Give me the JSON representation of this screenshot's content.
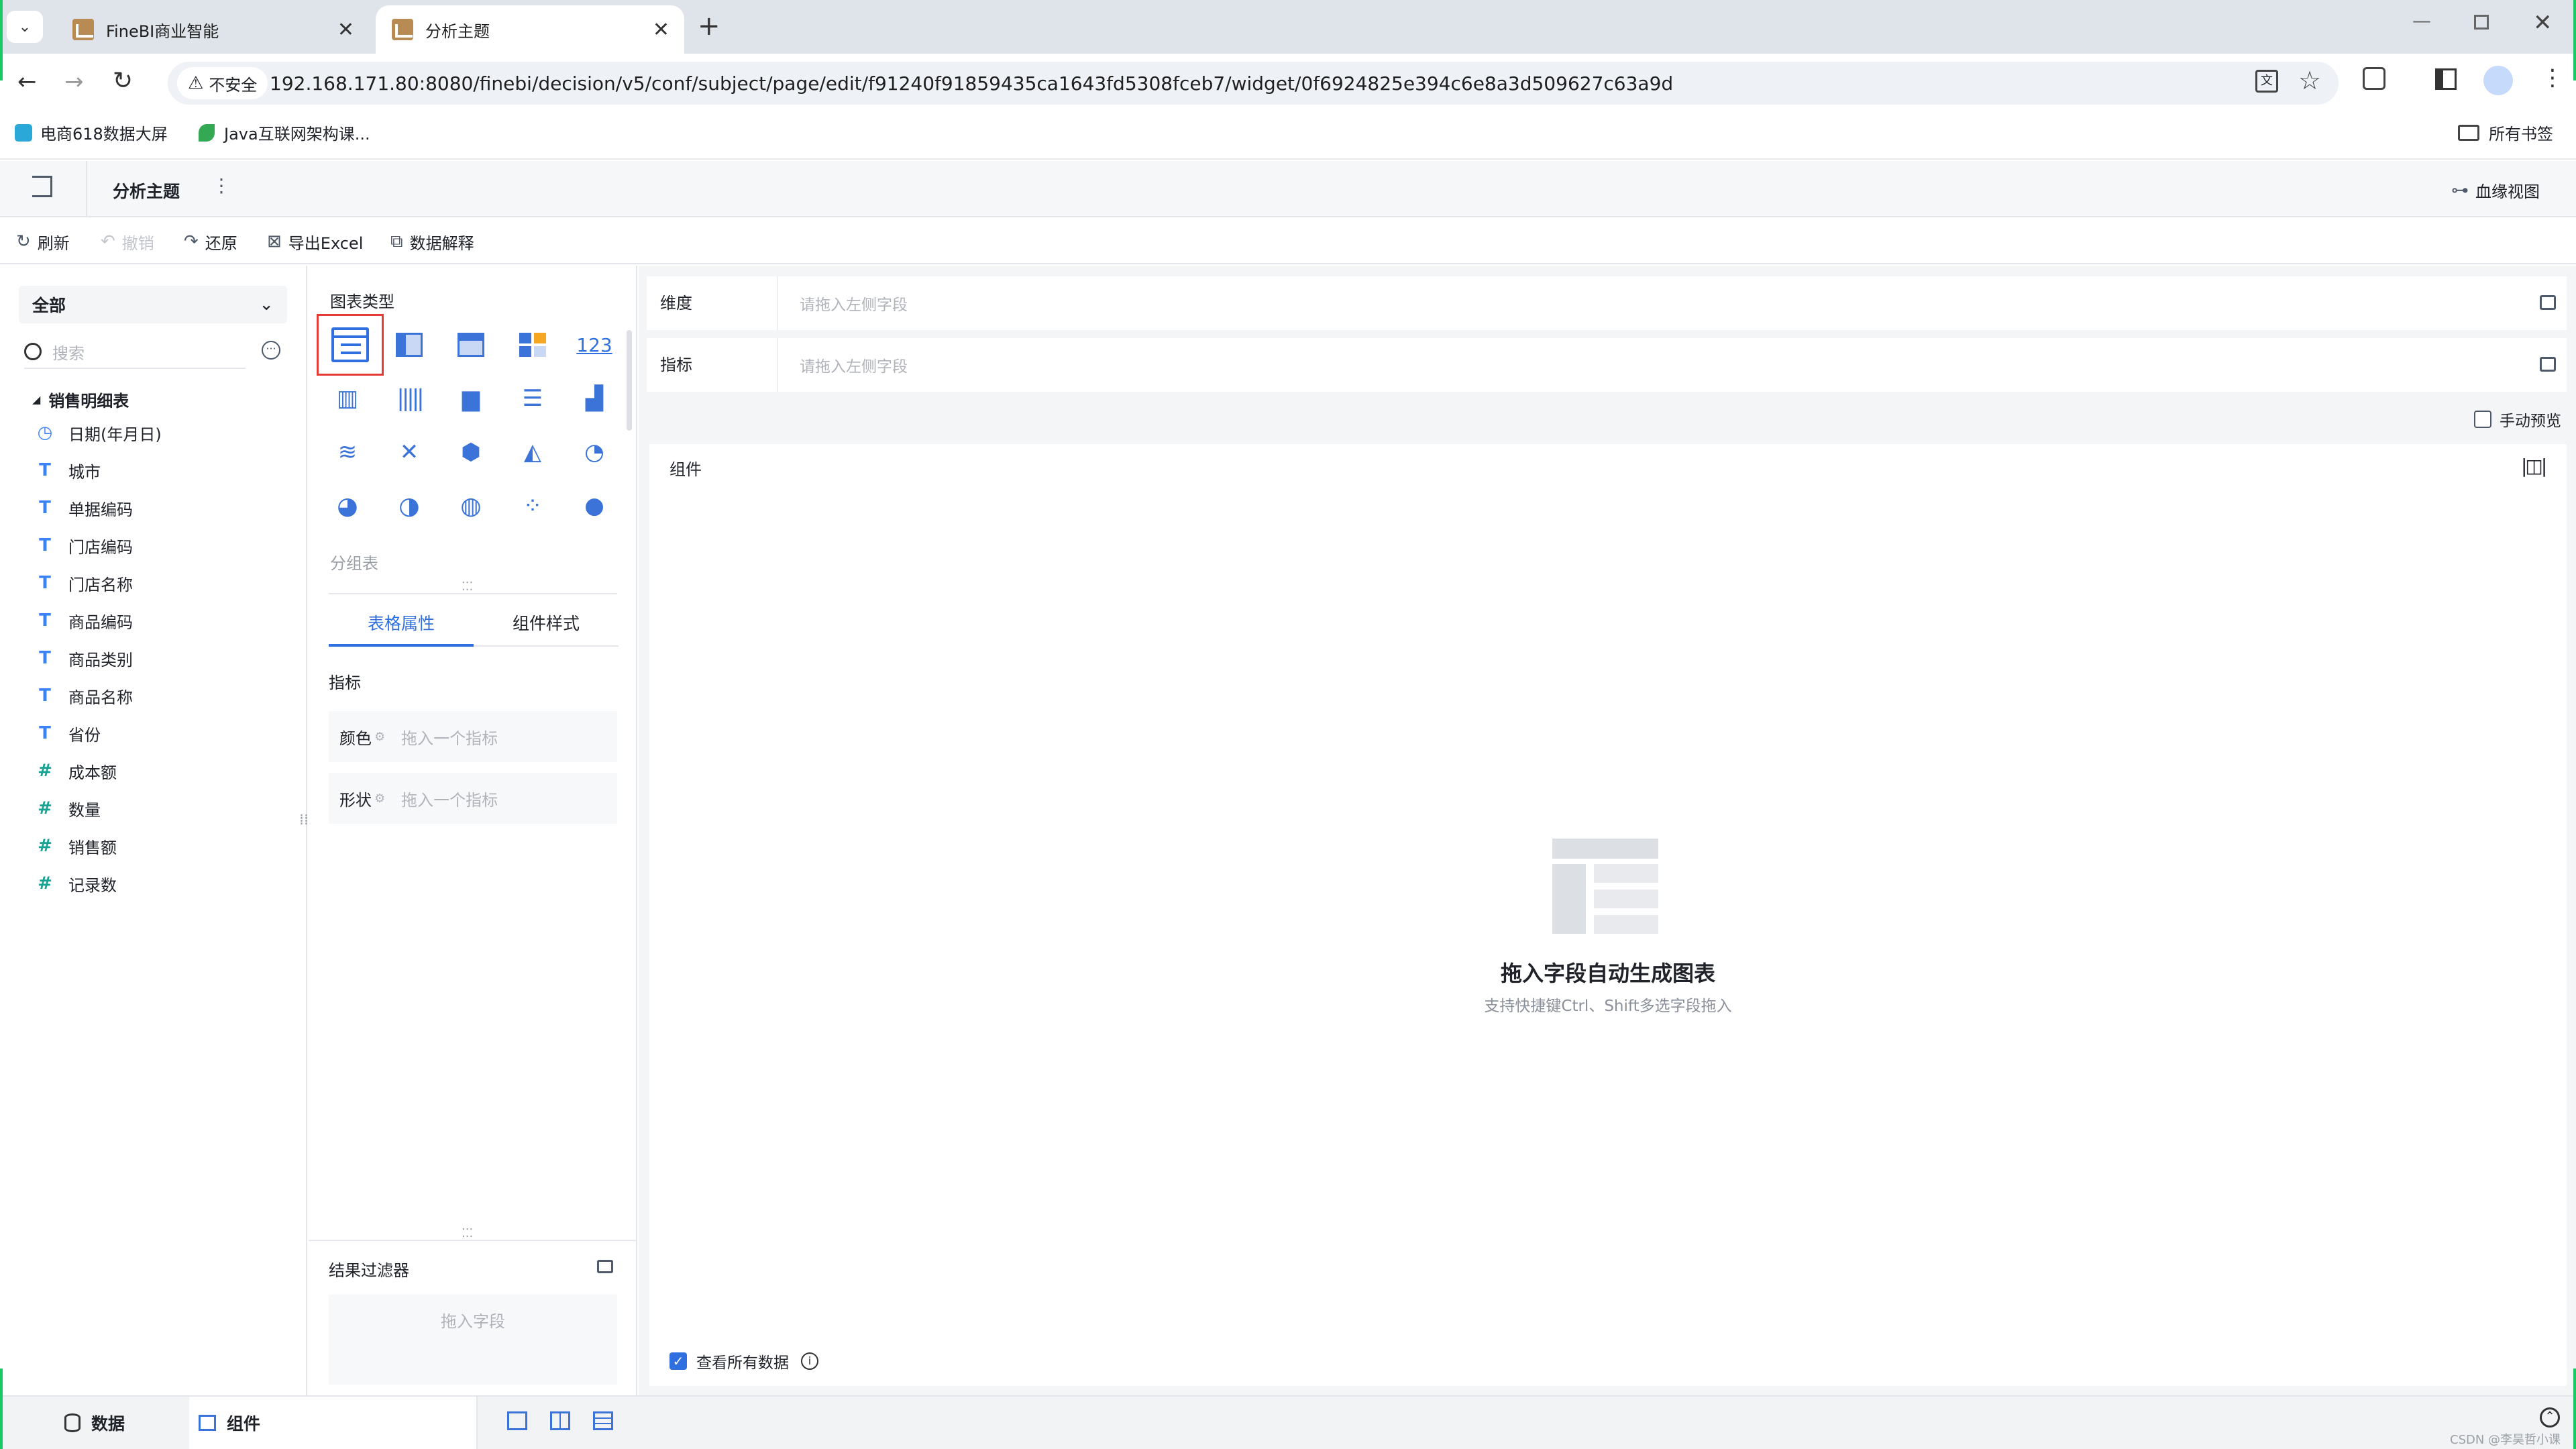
{
  "browser": {
    "tabs": [
      {
        "title": "FineBI商业智能",
        "active": false
      },
      {
        "title": "分析主题",
        "active": true
      }
    ],
    "url": "192.168.171.80:8080/finebi/decision/v5/conf/subject/page/edit/f91240f91859435ca1643fd5308fceb7/widget/0f6924825e394c6e8a3d509627c63a9d",
    "security_label": "不安全",
    "bookmarks": [
      {
        "label": "电商618数据大屏"
      },
      {
        "label": "Java互联网架构课..."
      }
    ],
    "all_bookmarks": "所有书签"
  },
  "app": {
    "title": "分析主题",
    "lineage": "血缘视图",
    "actions": {
      "refresh": "刷新",
      "undo": "撤销",
      "redo": "还原",
      "export": "导出Excel",
      "explain": "数据解释"
    }
  },
  "left": {
    "scope": "全部",
    "search_placeholder": "搜索",
    "table_name": "销售明细表",
    "fields": [
      {
        "label": "日期(年月日)",
        "kind": "date"
      },
      {
        "label": "城市",
        "kind": "text"
      },
      {
        "label": "单据编码",
        "kind": "text"
      },
      {
        "label": "门店编码",
        "kind": "text"
      },
      {
        "label": "门店名称",
        "kind": "text"
      },
      {
        "label": "商品编码",
        "kind": "text"
      },
      {
        "label": "商品类别",
        "kind": "text"
      },
      {
        "label": "商品名称",
        "kind": "text"
      },
      {
        "label": "省份",
        "kind": "text"
      },
      {
        "label": "成本额",
        "kind": "number"
      },
      {
        "label": "数量",
        "kind": "number"
      },
      {
        "label": "销售额",
        "kind": "number"
      },
      {
        "label": "记录数",
        "kind": "number"
      }
    ]
  },
  "middle": {
    "chart_type_title": "图表类型",
    "selected_chart_name": "分组表",
    "chart_icon_123": "123",
    "tabs": [
      {
        "label": "表格属性",
        "active": true
      },
      {
        "label": "组件样式",
        "active": false
      }
    ],
    "metric_section": "指标",
    "color_label": "颜色",
    "color_placeholder": "拖入一个指标",
    "shape_label": "形状",
    "shape_placeholder": "拖入一个指标",
    "filter_title": "结果过滤器",
    "filter_placeholder": "拖入字段"
  },
  "right": {
    "dimension_label": "维度",
    "dimension_placeholder": "请拖入左侧字段",
    "metric_label": "指标",
    "metric_placeholder": "请拖入左侧字段",
    "manual_preview": "手动预览",
    "component_title": "组件",
    "empty_title": "拖入字段自动生成图表",
    "empty_subtitle": "支持快捷键Ctrl、Shift多选字段拖入",
    "view_all_data": "查看所有数据"
  },
  "bottom": {
    "data_tab": "数据",
    "component_tab": "组件",
    "watermark": "CSDN @李昊哲小课"
  },
  "colors": {
    "accent": "#2f6fe0",
    "selected_border": "#e53935",
    "text_field_icon": "#3b82f6",
    "number_field_icon": "#16a393"
  }
}
